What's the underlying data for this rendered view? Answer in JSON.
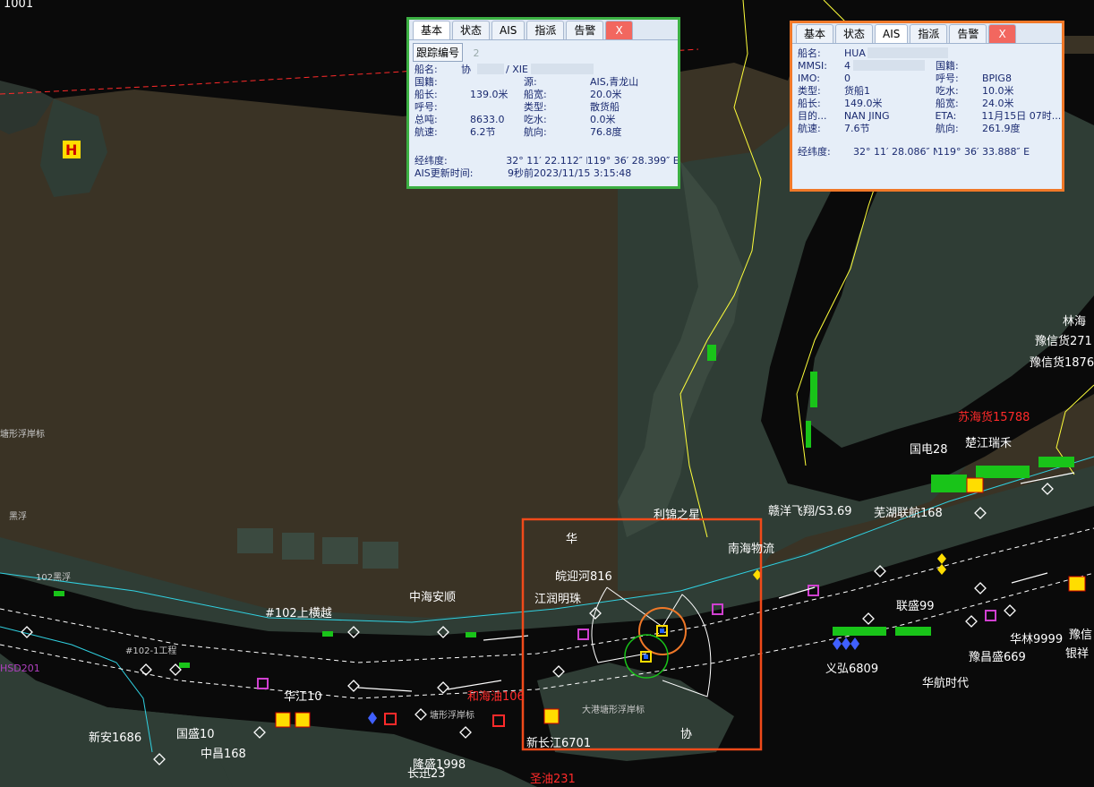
{
  "map": {
    "colors": {
      "land": "#3a3325",
      "water": "#0a0a0a",
      "wetland": "#2f3d35",
      "route": "#ffffff",
      "boundary": "#ffff3a",
      "alert": "#ff2a2a"
    },
    "top_left_number": "1001",
    "labels": {
      "hx": "H",
      "linhai": "林海",
      "yuxinhuo271": "豫信货271",
      "yuxinhuo1876": "豫信货1876",
      "suhaihuo": "苏海货15788",
      "guodian": "国电28",
      "chujiang": "楚江瑞禾",
      "ganyang": "赣洋飞翔/S3.69",
      "wuhu": "芜湖联航168",
      "lijin": "利锦之星",
      "nanhai": "南海物流",
      "hua_top": "华",
      "wanying": "皖迎河816",
      "jiangrun": "江润明珠",
      "zhonghai": "中海安顺",
      "lianshen": "联盛99",
      "yichang": "豫昌盛669",
      "hualin": "华林9999",
      "yuxin": "豫信",
      "yinxiang": "银祥",
      "yihong": "义弘6809",
      "huahang": "华航时代",
      "huajiang": "华江10",
      "hehaiyou": "和海油106",
      "xinan": "新安1686",
      "guosheng": "国盛10",
      "zhongchang": "中昌168",
      "longsheng": "隆盛1998",
      "changxun": "长迅23",
      "xinchangjiang": "新长江6701",
      "shengyou": "圣油231",
      "xie": "协",
      "hsd": "HSD201",
      "n102": "#102上横越",
      "n102b": "#102-1工程",
      "fuba_left": "102黑浮",
      "dagang": "大港塘形浮岸标",
      "taxing": "塘形浮岸标",
      "taxing2": "塘形浮岸标",
      "fuzhi": "黑浮"
    }
  },
  "panel_left": {
    "tabs": [
      "基本",
      "状态",
      "AIS",
      "指派",
      "告警",
      "X"
    ],
    "track_label": "跟踪编号",
    "track_value": "2",
    "ship_name_label": "船名:",
    "ship_name_value": "协",
    "ship_name_en": "/ XIE",
    "nation_label": "国籍:",
    "source_label": "源:",
    "source_value": "AIS,青龙山",
    "length_label": "船长:",
    "length_value": "139.0米",
    "width_label": "船宽:",
    "width_value": "20.0米",
    "callsign_label": "呼号:",
    "type_label": "类型:",
    "type_value": "散货船",
    "tonnage_label": "总吨:",
    "tonnage_value": "8633.0",
    "draft_label": "吃水:",
    "draft_value": "0.0米",
    "speed_label": "航速:",
    "speed_value": "6.2节",
    "course_label": "航向:",
    "course_value": "76.8度",
    "latlon_label": "经纬度:",
    "lat_value": "32° 11′ 22.112″ N",
    "lon_value": "119° 36′ 28.399″ E",
    "ais_update_label": "AIS更新时间:",
    "ais_update_value": "9秒前2023/11/15  3:15:48"
  },
  "panel_right": {
    "tabs": [
      "基本",
      "状态",
      "AIS",
      "指派",
      "告警",
      "X"
    ],
    "ship_name_label": "船名:",
    "ship_name_value": "HUA",
    "mmsi_label": "MMSI:",
    "mmsi_value": "4",
    "nation_label": "国籍:",
    "imo_label": "IMO:",
    "imo_value": "0",
    "callsign_label": "呼号:",
    "callsign_value": "BPIG8",
    "type_label": "类型:",
    "type_value": "货船1",
    "draft_label": "吃水:",
    "draft_value": "10.0米",
    "length_label": "船长:",
    "length_value": "149.0米",
    "width_label": "船宽:",
    "width_value": "24.0米",
    "dest_label": "目的...",
    "dest_value": "NAN JING",
    "eta_label": "ETA:",
    "eta_value": "11月15日 07时...",
    "speed_label": "航速:",
    "speed_value": "7.6节",
    "course_label": "航向:",
    "course_value": "261.9度",
    "latlon_label": "经纬度:",
    "lat_value": "32° 11′ 28.086″ N",
    "lon_value": "119° 36′ 33.888″ E"
  }
}
